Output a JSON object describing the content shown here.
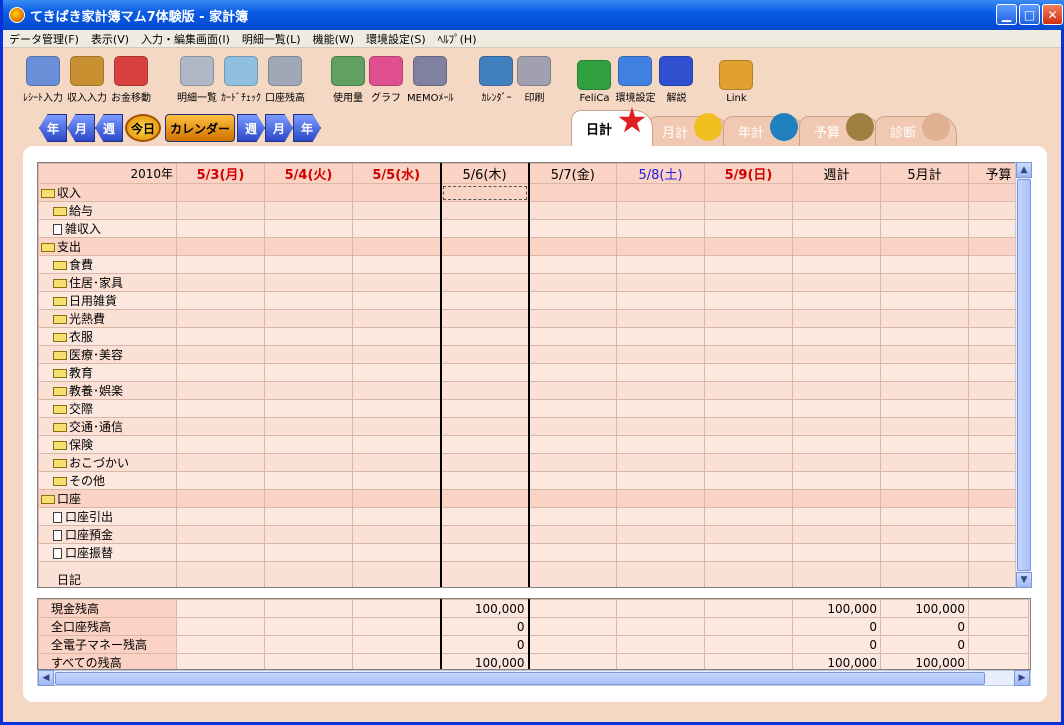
{
  "window": {
    "title": "てきぱき家計簿マム7体験版 - 家計簿"
  },
  "menu": [
    "データ管理(F)",
    "表示(V)",
    "入力・編集画面(I)",
    "明細一覧(L)",
    "機能(W)",
    "環境設定(S)",
    "ﾍﾙﾌﾟ(H)"
  ],
  "toolbar": [
    {
      "label": "ﾚｼｰﾄ入力",
      "color": "#6a8fd8"
    },
    {
      "label": "収入入力",
      "color": "#c89030"
    },
    {
      "label": "お金移動",
      "color": "#d84040"
    },
    {
      "label": "明細一覧",
      "color": "#b0b8c8"
    },
    {
      "label": "ｶｰﾄﾞﾁｪｯｸ",
      "color": "#90c0e0"
    },
    {
      "label": "口座残高",
      "color": "#a0a8b8"
    },
    {
      "label": "使用量",
      "color": "#60a060"
    },
    {
      "label": "グラフ",
      "color": "#e05090"
    },
    {
      "label": "MEMOﾒｰﾙ",
      "color": "#8080a0"
    },
    {
      "label": "ｶﾚﾝﾀﾞｰ",
      "color": "#4080c0"
    },
    {
      "label": "印刷",
      "color": "#a0a0b0"
    },
    {
      "label": "FeliCa",
      "color": "#30a040"
    },
    {
      "label": "環境設定",
      "color": "#4080e0"
    },
    {
      "label": "解説",
      "color": "#3050d0"
    },
    {
      "label": "Link",
      "color": "#e0a030"
    }
  ],
  "nav": [
    "年",
    "月",
    "週",
    "今日",
    "カレンダー",
    "週",
    "月",
    "年"
  ],
  "tabs": [
    {
      "label": "日計",
      "active": true,
      "icon": "sun-icon",
      "color": "#e02020"
    },
    {
      "label": "月計",
      "active": false,
      "icon": "moon-icon",
      "color": "#f0c020"
    },
    {
      "label": "年計",
      "active": false,
      "icon": "earth-icon",
      "color": "#2080c0"
    },
    {
      "label": "予算",
      "active": false,
      "icon": "budget-icon",
      "color": "#a08040"
    },
    {
      "label": "診断",
      "active": false,
      "icon": "doctor-icon",
      "color": "#e0b090"
    }
  ],
  "grid": {
    "year_label": "2010年",
    "columns": [
      {
        "label": "5/3(月)",
        "type": "hol"
      },
      {
        "label": "5/4(火)",
        "type": "hol"
      },
      {
        "label": "5/5(水)",
        "type": "hol"
      },
      {
        "label": "5/6(木)",
        "type": "normal"
      },
      {
        "label": "5/7(金)",
        "type": "normal"
      },
      {
        "label": "5/8(土)",
        "type": "sat"
      },
      {
        "label": "5/9(日)",
        "type": "hol"
      },
      {
        "label": "週計",
        "type": "normal"
      },
      {
        "label": "5月計",
        "type": "normal"
      },
      {
        "label": "予算",
        "type": "normal"
      }
    ],
    "rows": [
      {
        "label": "収入",
        "kind": "group"
      },
      {
        "label": "給与",
        "kind": "folder"
      },
      {
        "label": "雑収入",
        "kind": "doc"
      },
      {
        "label": "支出",
        "kind": "group"
      },
      {
        "label": "食費",
        "kind": "folder"
      },
      {
        "label": "住居･家具",
        "kind": "folder"
      },
      {
        "label": "日用雑貨",
        "kind": "folder"
      },
      {
        "label": "光熱費",
        "kind": "folder"
      },
      {
        "label": "衣服",
        "kind": "folder"
      },
      {
        "label": "医療･美容",
        "kind": "folder"
      },
      {
        "label": "教育",
        "kind": "folder"
      },
      {
        "label": "教養･娯楽",
        "kind": "folder"
      },
      {
        "label": "交際",
        "kind": "folder"
      },
      {
        "label": "交通･通信",
        "kind": "folder"
      },
      {
        "label": "保険",
        "kind": "folder"
      },
      {
        "label": "おこづかい",
        "kind": "folder"
      },
      {
        "label": "その他",
        "kind": "folder"
      },
      {
        "label": "口座",
        "kind": "group"
      },
      {
        "label": "口座引出",
        "kind": "doc"
      },
      {
        "label": "口座預金",
        "kind": "doc"
      },
      {
        "label": "口座振替",
        "kind": "doc"
      },
      {
        "label": "日記",
        "kind": "diary"
      }
    ]
  },
  "summary": [
    {
      "label": "現金残高",
      "values": [
        "",
        "",
        "",
        "100,000",
        "",
        "",
        "",
        "100,000",
        "100,000",
        ""
      ]
    },
    {
      "label": "全口座残高",
      "values": [
        "",
        "",
        "",
        "0",
        "",
        "",
        "",
        "0",
        "0",
        ""
      ]
    },
    {
      "label": "全電子マネー残高",
      "values": [
        "",
        "",
        "",
        "0",
        "",
        "",
        "",
        "0",
        "0",
        ""
      ]
    },
    {
      "label": "すべての残高",
      "values": [
        "",
        "",
        "",
        "100,000",
        "",
        "",
        "",
        "100,000",
        "100,000",
        ""
      ]
    }
  ]
}
